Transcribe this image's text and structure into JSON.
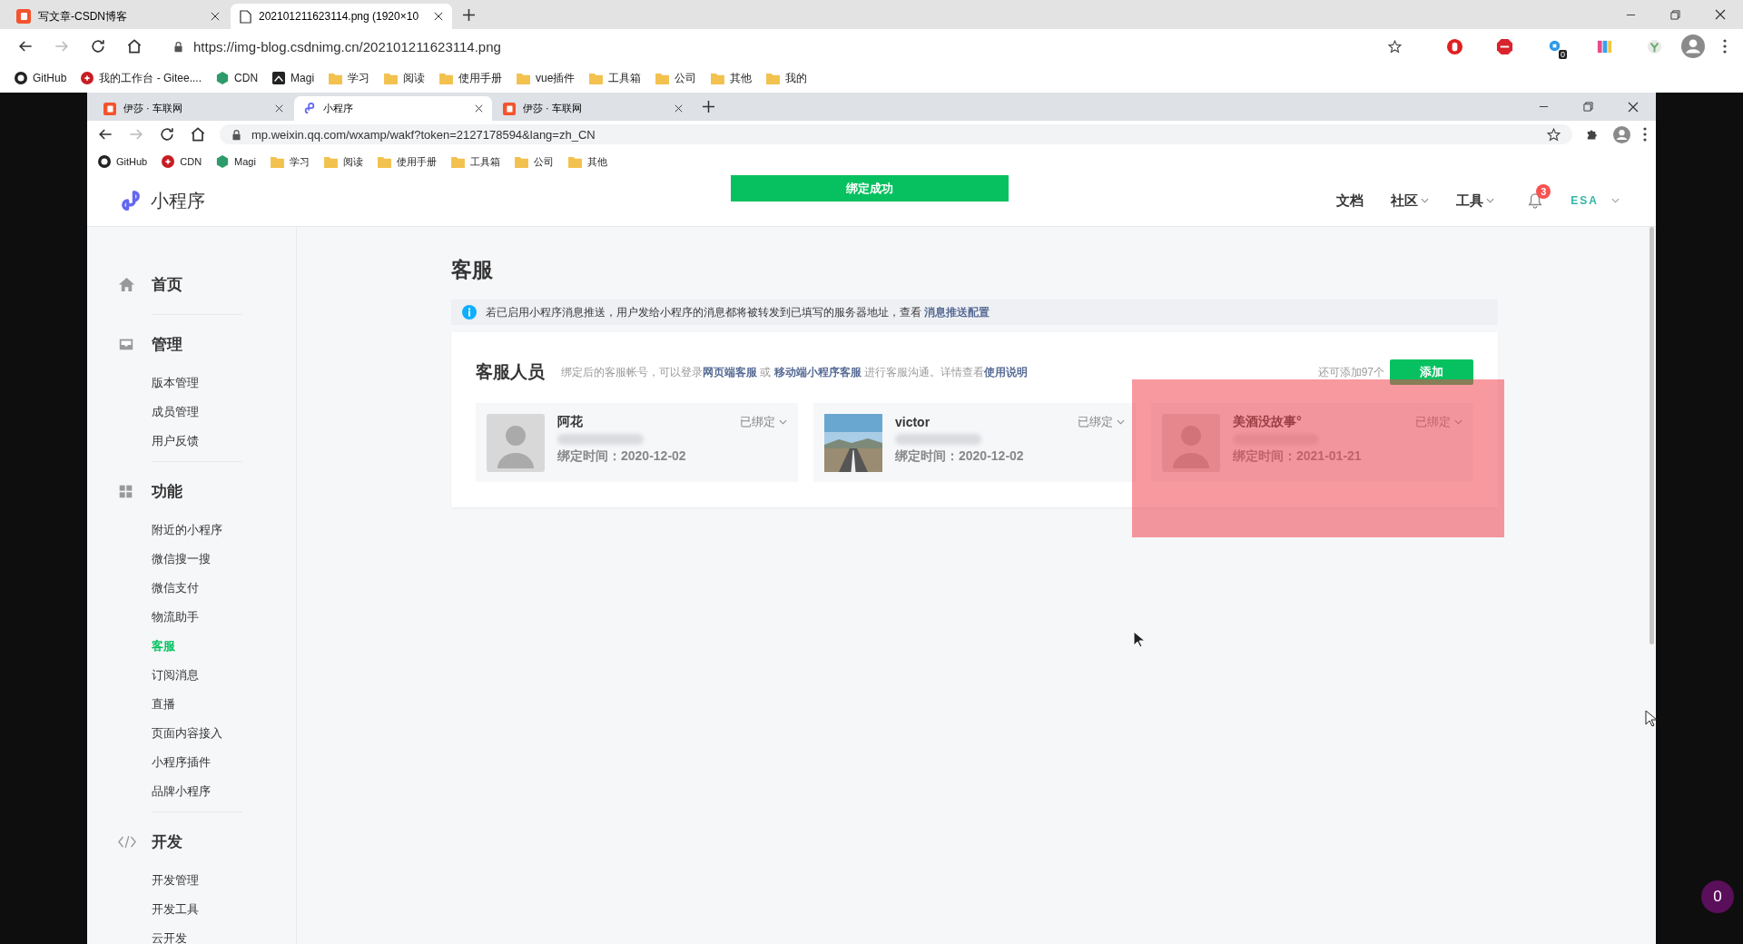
{
  "outer_browser": {
    "tabs": [
      {
        "title": "写文章-CSDN博客",
        "kind": "site",
        "selected": false
      },
      {
        "title": "202101211623114.png (1920×10",
        "kind": "file",
        "selected": true
      }
    ],
    "address": "https://img-blog.csdnimg.cn/202101211623114.png",
    "extension_badge": "0",
    "bookmarks": [
      {
        "label": "GitHub",
        "kind": "site"
      },
      {
        "label": "我的工作台 - Gitee....",
        "kind": "site"
      },
      {
        "label": "CDN",
        "kind": "site"
      },
      {
        "label": "Magi",
        "kind": "site"
      },
      {
        "label": "学习",
        "kind": "folder"
      },
      {
        "label": "阅读",
        "kind": "folder"
      },
      {
        "label": "使用手册",
        "kind": "folder"
      },
      {
        "label": "vue插件",
        "kind": "folder"
      },
      {
        "label": "工具箱",
        "kind": "folder"
      },
      {
        "label": "公司",
        "kind": "folder"
      },
      {
        "label": "其他",
        "kind": "folder"
      },
      {
        "label": "我的",
        "kind": "folder"
      }
    ]
  },
  "inner_browser": {
    "tabs": [
      {
        "title": "伊莎 · 车联网",
        "kind": "site",
        "selected": false
      },
      {
        "title": "小程序",
        "kind": "app",
        "selected": true
      },
      {
        "title": "伊莎 · 车联网",
        "kind": "site",
        "selected": false
      }
    ],
    "address": "mp.weixin.qq.com/wxamp/wakf?token=2127178594&lang=zh_CN",
    "bookmarks": [
      {
        "label": "GitHub",
        "kind": "site"
      },
      {
        "label": "CDN",
        "kind": "site"
      },
      {
        "label": "Magi",
        "kind": "site"
      },
      {
        "label": "学习",
        "kind": "folder"
      },
      {
        "label": "阅读",
        "kind": "folder"
      },
      {
        "label": "使用手册",
        "kind": "folder"
      },
      {
        "label": "工具箱",
        "kind": "folder"
      },
      {
        "label": "公司",
        "kind": "folder"
      },
      {
        "label": "其他",
        "kind": "folder"
      }
    ]
  },
  "header": {
    "logo_text": "小程序",
    "toast": "绑定成功",
    "nav": [
      {
        "label": "文档",
        "kind": "link"
      },
      {
        "label": "社区",
        "kind": "dropdown"
      },
      {
        "label": "工具",
        "kind": "dropdown"
      }
    ],
    "notification_count": "3",
    "account": "ESA"
  },
  "sidebar": {
    "sections": [
      {
        "label": "首页"
      },
      {
        "label": "管理",
        "items": [
          {
            "label": "版本管理",
            "selected": false
          },
          {
            "label": "成员管理",
            "selected": false
          },
          {
            "label": "用户反馈",
            "selected": false
          }
        ]
      },
      {
        "label": "功能",
        "items": [
          {
            "label": "附近的小程序",
            "selected": false
          },
          {
            "label": "微信搜一搜",
            "selected": false
          },
          {
            "label": "微信支付",
            "selected": false
          },
          {
            "label": "物流助手",
            "selected": false
          },
          {
            "label": "客服",
            "selected": true
          },
          {
            "label": "订阅消息",
            "selected": false
          },
          {
            "label": "直播",
            "selected": false
          },
          {
            "label": "页面内容接入",
            "selected": false
          },
          {
            "label": "小程序插件",
            "selected": false
          },
          {
            "label": "品牌小程序",
            "selected": false
          }
        ]
      },
      {
        "label": "开发",
        "items": [
          {
            "label": "开发管理",
            "selected": false
          },
          {
            "label": "开发工具",
            "selected": false
          },
          {
            "label": "云开发",
            "selected": false
          }
        ]
      }
    ]
  },
  "main": {
    "title": "客服",
    "notice": {
      "text": "若已启用小程序消息推送，用户发给小程序的消息都将被转发到已填写的服务器地址，查看 ",
      "link": "消息推送配置"
    },
    "staff": {
      "title": "客服人员",
      "description": [
        {
          "text": "绑定后的客服帐号，可以登录",
          "link": false
        },
        {
          "text": "网页端客服",
          "link": true
        },
        {
          "text": " 或 ",
          "link": false
        },
        {
          "text": "移动端小程序客服",
          "link": true
        },
        {
          "text": " 进行客服沟通。详情查看",
          "link": false
        },
        {
          "text": "使用说明",
          "link": true
        }
      ],
      "quota": "还可添加97个",
      "add_button": "添加",
      "members": [
        {
          "name": "阿花",
          "kind": "person",
          "status": "已绑定",
          "bound_time": "绑定时间：2020-12-02"
        },
        {
          "name": "victor",
          "kind": "picture",
          "status": "已绑定",
          "bound_time": "绑定时间：2020-12-02"
        },
        {
          "name": "美酒没故事°",
          "kind": "person",
          "status": "已绑定",
          "bound_time": "绑定时间：2021-01-21"
        }
      ]
    }
  },
  "viewer": {
    "badge": "0"
  }
}
